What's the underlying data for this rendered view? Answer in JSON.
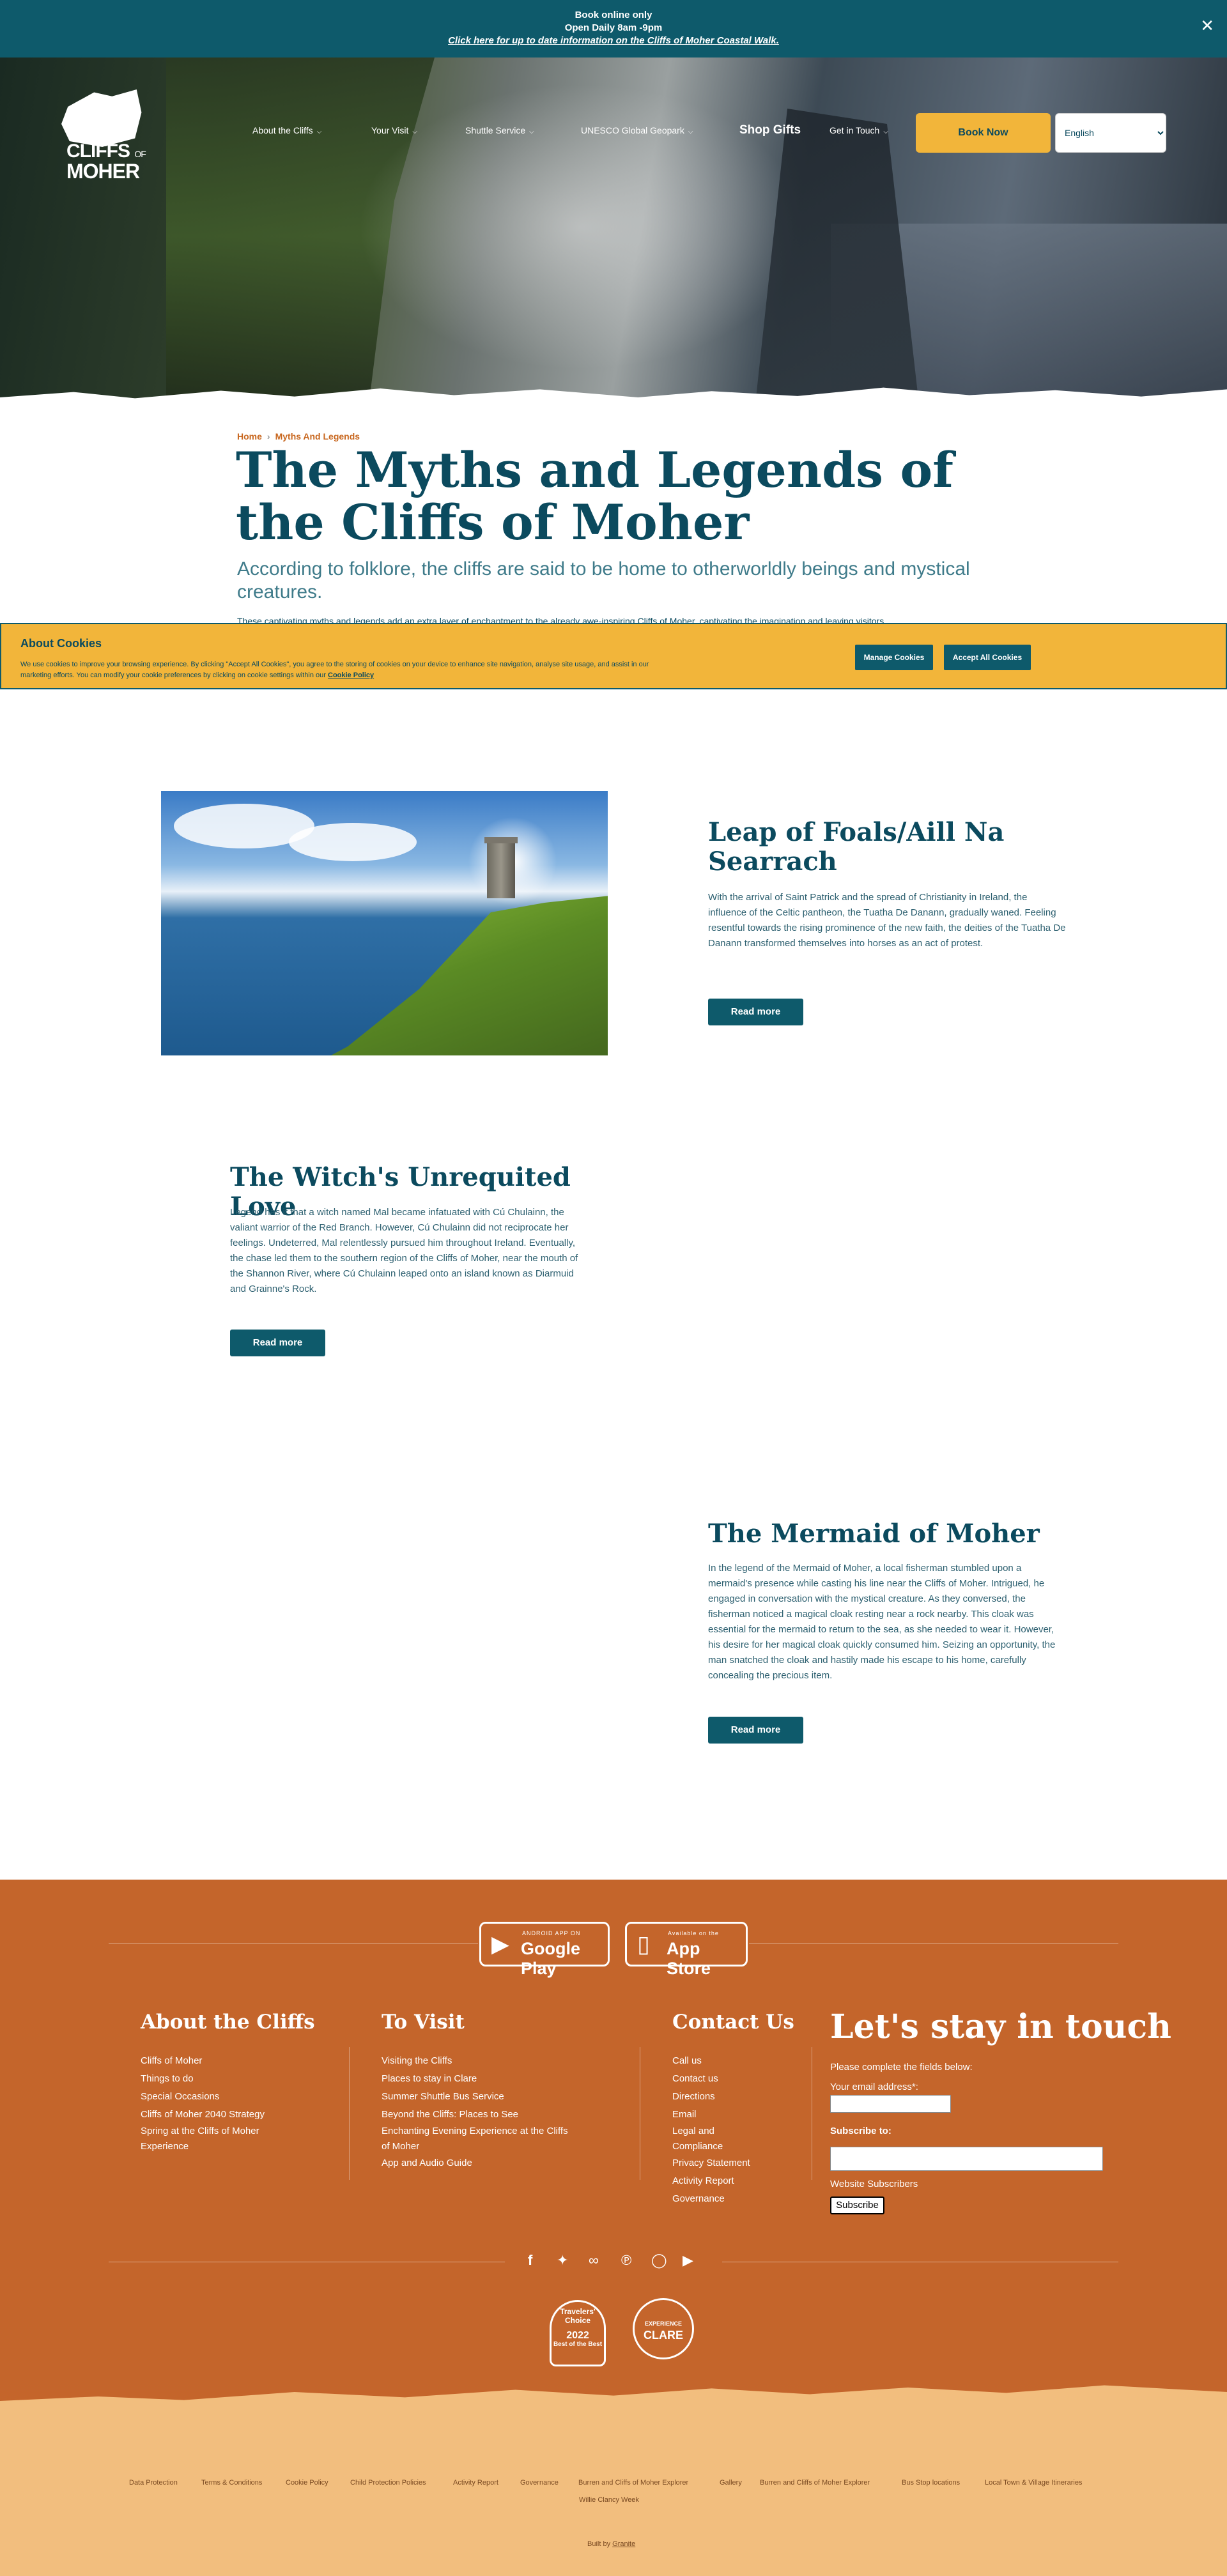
{
  "announcement": {
    "line1": "Book online only",
    "line2": "Open Daily 8am -9pm",
    "link": "Click here for up to date information on the Cliffs of Moher Coastal Walk.",
    "close": "✕"
  },
  "logo": {
    "line1": "CLIFFS",
    "of": "OF",
    "line2": "MOHER"
  },
  "nav": {
    "items": [
      "About the Cliffs",
      "Your Visit",
      "Shuttle Service",
      "UNESCO Global Geopark",
      "Shop Gifts",
      "Get in Touch"
    ],
    "book": "Book Now",
    "language": "English"
  },
  "breadcrumb": {
    "home": "Home",
    "current": "Myths And Legends"
  },
  "page": {
    "title": "The Myths and Legends of the Cliffs of Moher",
    "subtitle": "According to folklore, the cliffs are said to be home to otherworldly beings and mystical creatures.",
    "intro": "These captivating myths and legends add an extra layer of enchantment to the already awe-inspiring Cliffs of Moher, captivating the imagination and leaving visitors"
  },
  "cookie": {
    "title": "About Cookies",
    "text": "We use cookies to improve your browsing experience. By clicking \"Accept All Cookies\", you agree to the storing of cookies on your device to enhance site navigation, analyse site usage, and assist in our marketing efforts. You can modify your cookie preferences by clicking on cookie settings within our",
    "policy": "Cookie Policy",
    "manage": "Manage Cookies",
    "accept": "Accept All Cookies"
  },
  "sections": [
    {
      "title": "Leap of Foals/Aill Na Searrach",
      "text": "With the arrival of Saint Patrick and the spread of Christianity in Ireland, the influence of the Celtic pantheon, the Tuatha De Danann, gradually waned. Feeling resentful towards the rising prominence of the new faith, the deities of the Tuatha De Danann transformed themselves into horses as an act of protest.",
      "button": "Read more"
    },
    {
      "title": "The Witch's Unrequited Love",
      "text": "Legend has it that a witch named Mal became infatuated with Cú Chulainn, the valiant warrior of the Red Branch. However, Cú Chulainn did not reciprocate her feelings. Undeterred, Mal relentlessly pursued him throughout Ireland. Eventually, the chase led them to the southern region of the Cliffs of Moher, near the mouth of the Shannon River, where Cú Chulainn leaped onto an island known as Diarmuid and Grainne's Rock.",
      "button": "Read more"
    },
    {
      "title": "The Mermaid of Moher",
      "text": "In the legend of the Mermaid of Moher, a local fisherman stumbled upon a mermaid's presence while casting his line near the Cliffs of Moher. Intrigued, he engaged in conversation with the mystical creature. As they conversed, the fisherman noticed a magical cloak resting near a rock nearby. This cloak was essential for the mermaid to return to the sea, as she needed to wear it. However, his desire for her magical cloak quickly consumed him. Seizing an opportunity, the man snatched the cloak and hastily made his escape to his home, carefully concealing the precious item.",
      "button": "Read more"
    }
  ],
  "footer": {
    "google_play": {
      "small": "ANDROID APP ON",
      "big": "Google Play"
    },
    "app_store": {
      "small": "Available on the",
      "big": "App Store"
    },
    "about": {
      "title": "About the Cliffs",
      "links": [
        "Cliffs of Moher",
        "Things to do",
        "Special Occasions",
        "Cliffs of Moher 2040 Strategy",
        "Spring at the Cliffs of Moher Experience"
      ]
    },
    "visit": {
      "title": "To Visit",
      "links": [
        "Visiting the Cliffs",
        "Places to stay in Clare",
        "Summer Shuttle Bus Service",
        "Beyond the Cliffs: Places to See",
        "Enchanting Evening Experience at the Cliffs of Moher",
        "App and Audio Guide"
      ]
    },
    "contact": {
      "title": "Contact Us",
      "links": [
        "Call us",
        "Contact us",
        "Directions",
        "Email",
        "Legal and Compliance",
        "Privacy Statement",
        "Activity Report",
        "Governance"
      ]
    },
    "stay": {
      "title": "Let's stay in touch",
      "intro": "Please complete the fields below:",
      "email_label": "Your email address*:",
      "subscribe_label": "Subscribe to:",
      "subscribers": "Website Subscribers",
      "button": "Subscribe"
    },
    "social": [
      "facebook-icon",
      "twitter-icon",
      "tripadvisor-icon",
      "pinterest-icon",
      "instagram-icon",
      "youtube-icon"
    ],
    "award1": {
      "line1": "Travelers'",
      "line2": "Choice",
      "year": "2022",
      "line3": "Best of the Best"
    },
    "award2": {
      "line1": "EXPERIENCE",
      "line2": "CLARE"
    },
    "bottom_links": [
      "Data Protection",
      "Terms & Conditions",
      "Cookie Policy",
      "Child Protection Policies",
      "Activity Report",
      "Governance",
      "Burren and Cliffs of Moher Explorer",
      "Gallery",
      "Burren and Cliffs of Moher Explorer",
      "Bus Stop locations",
      "Local Town & Village Itineraries",
      "Willie Clancy Week"
    ],
    "built_by": "Built by",
    "built_link": "Granite"
  },
  "colors": {
    "teal": "#0e5a6b",
    "navy": "#0b4a5e",
    "gold": "#f2b53a",
    "orange": "#c4652b",
    "sand": "#f2be7e"
  }
}
